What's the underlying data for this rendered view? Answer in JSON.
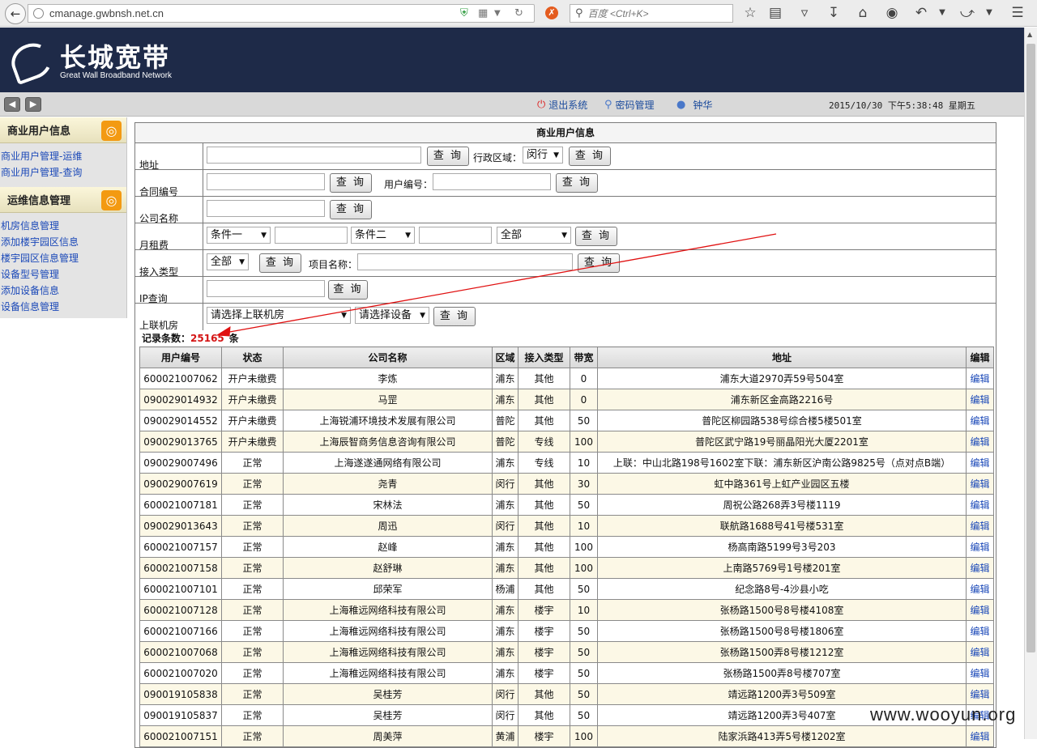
{
  "browser": {
    "url": "cmanage.gwbnsh.net.cn",
    "search_placeholder": "百度 <Ctrl+K>"
  },
  "logo": {
    "cn": "长城宽带",
    "en": "Great Wall Broadband Network"
  },
  "nav": {
    "logout": "退出系统",
    "password": "密码管理",
    "user": "钟华",
    "datetime": "2015/10/30 下午5:38:48 星期五"
  },
  "sidebar": {
    "group1": {
      "title": "商业用户信息",
      "items": [
        "商业用户管理-运维",
        "商业用户管理-查询"
      ]
    },
    "group2": {
      "title": "运维信息管理",
      "items": [
        "机房信息管理",
        "添加楼宇园区信息",
        "楼宇园区信息管理",
        "设备型号管理",
        "添加设备信息",
        "设备信息管理"
      ]
    }
  },
  "panel": {
    "title": "商业用户信息"
  },
  "form": {
    "query_label": "查 询",
    "address_label": "地址",
    "district_label": "行政区域：",
    "district_value": "闵行",
    "contract_label": "合同编号",
    "userid_label": "用户编号：",
    "company_label": "公司名称",
    "rent_label": "月租费",
    "cond1": "条件一",
    "cond2": "条件二",
    "all": "全部",
    "access_label": "接入类型",
    "access_value": "全部",
    "project_label": "项目名称：",
    "ip_label": "IP查询",
    "room_label": "上联机房",
    "room_value": "请选择上联机房",
    "device_value": "请选择设备"
  },
  "records": {
    "label": "记录条数：",
    "count": "25165",
    "unit": "条"
  },
  "table": {
    "headers": [
      "用户编号",
      "状态",
      "公司名称",
      "区域",
      "接入类型",
      "带宽",
      "地址",
      "编辑"
    ],
    "rows": [
      [
        "600021007062",
        "开户未缴费",
        "李炼",
        "浦东",
        "其他",
        "0",
        "浦东大道2970弄59号504室",
        "编辑"
      ],
      [
        "090029014932",
        "开户未缴费",
        "马罡",
        "浦东",
        "其他",
        "0",
        "浦东新区金高路2216号",
        "编辑"
      ],
      [
        "090029014552",
        "开户未缴费",
        "上海锐浦环境技术发展有限公司",
        "普陀",
        "其他",
        "50",
        "普陀区柳园路538号综合楼5楼501室",
        "编辑"
      ],
      [
        "090029013765",
        "开户未缴费",
        "上海辰智商务信息咨询有限公司",
        "普陀",
        "专线",
        "100",
        "普陀区武宁路19号丽晶阳光大厦2201室",
        "编辑"
      ],
      [
        "090029007496",
        "正常",
        "上海遂遂通网络有限公司",
        "浦东",
        "专线",
        "10",
        "上联：中山北路198号1602室下联：浦东新区沪南公路9825号（点对点B端）",
        "编辑"
      ],
      [
        "090029007619",
        "正常",
        "尧青",
        "闵行",
        "其他",
        "30",
        "虹中路361号上虹产业园区五楼",
        "编辑"
      ],
      [
        "600021007181",
        "正常",
        "宋林法",
        "浦东",
        "其他",
        "50",
        "周祝公路268弄3号楼1119",
        "编辑"
      ],
      [
        "090029013643",
        "正常",
        "周迅",
        "闵行",
        "其他",
        "10",
        "联航路1688号41号楼531室",
        "编辑"
      ],
      [
        "600021007157",
        "正常",
        "赵峰",
        "浦东",
        "其他",
        "100",
        "杨高南路5199号3号203",
        "编辑"
      ],
      [
        "600021007158",
        "正常",
        "赵舒琳",
        "浦东",
        "其他",
        "100",
        "上南路5769号1号楼201室",
        "编辑"
      ],
      [
        "600021007101",
        "正常",
        "邱荣军",
        "杨浦",
        "其他",
        "50",
        "纪念路8号-4沙县小吃",
        "编辑"
      ],
      [
        "600021007128",
        "正常",
        "上海稚远网络科技有限公司",
        "浦东",
        "楼宇",
        "10",
        "张杨路1500号8号楼4108室",
        "编辑"
      ],
      [
        "600021007166",
        "正常",
        "上海稚远网络科技有限公司",
        "浦东",
        "楼宇",
        "50",
        "张杨路1500号8号楼1806室",
        "编辑"
      ],
      [
        "600021007068",
        "正常",
        "上海稚远网络科技有限公司",
        "浦东",
        "楼宇",
        "50",
        "张杨路1500弄8号楼1212室",
        "编辑"
      ],
      [
        "600021007020",
        "正常",
        "上海稚远网络科技有限公司",
        "浦东",
        "楼宇",
        "50",
        "张杨路1500弄8号楼707室",
        "编辑"
      ],
      [
        "090019105838",
        "正常",
        "吴桂芳",
        "闵行",
        "其他",
        "50",
        "靖远路1200弄3号509室",
        "编辑"
      ],
      [
        "090019105837",
        "正常",
        "吴桂芳",
        "闵行",
        "其他",
        "50",
        "靖远路1200弄3号407室",
        "编辑"
      ],
      [
        "600021007151",
        "正常",
        "周美萍",
        "黄浦",
        "楼宇",
        "100",
        "陆家浜路413弄5号楼1202室",
        "编辑"
      ]
    ]
  },
  "watermark": "www.wooyun.org",
  "colors": {
    "header_bg": "#1e2a48",
    "accent_red": "#d41414",
    "link": "#1a48b8",
    "row_alt": "#fcf8e6"
  }
}
